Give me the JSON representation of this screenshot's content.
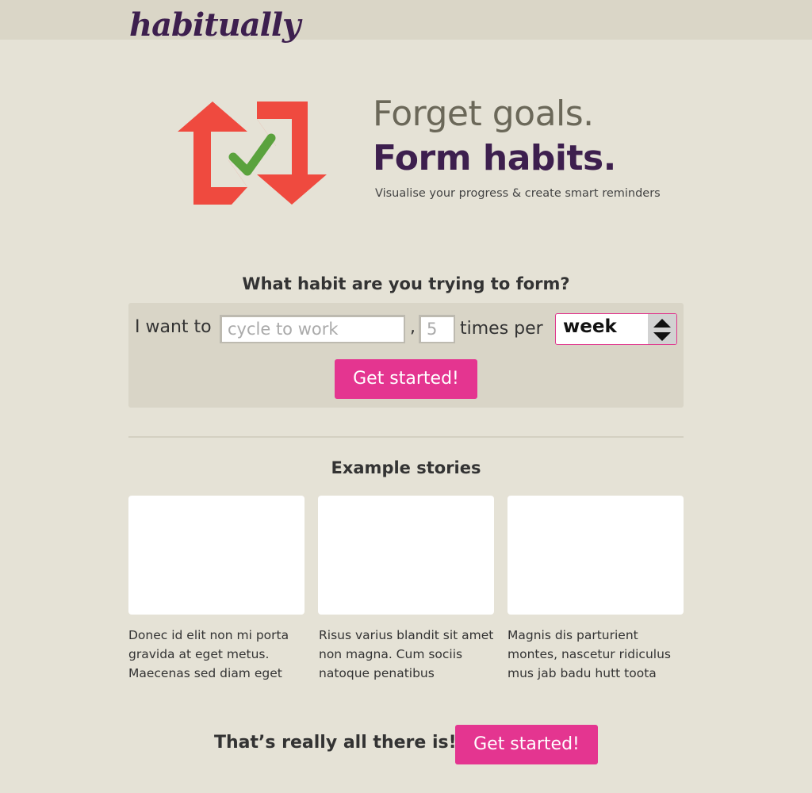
{
  "header": {
    "logo": "habitually"
  },
  "hero": {
    "icon": "refresh-check-icon",
    "headline_line1": "Forget goals.",
    "headline_line2": "Form habits.",
    "tagline": "Visualise your progress & create smart reminders"
  },
  "form": {
    "question": "What habit are you trying to form?",
    "label_want": "I want to",
    "habit_placeholder": "cycle to work",
    "comma": ",",
    "count_placeholder": "5",
    "label_times": "times per",
    "period_value": "week",
    "submit_label": "Get started!"
  },
  "stories": {
    "title": "Example stories",
    "items": [
      {
        "text": "Donec id elit non mi porta gravida at eget metus. Maecenas sed diam eget"
      },
      {
        "text": "Risus varius blandit sit amet non magna. Cum sociis natoque penatibus"
      },
      {
        "text": "Magnis dis parturient montes, nascetur ridiculus mus jab badu hutt toota"
      }
    ]
  },
  "cta": {
    "text": "That’s really all there is!",
    "button_label": "Get started!"
  },
  "colors": {
    "background": "#e5e2d6",
    "topbar": "#dad6c7",
    "brand_purple": "#3d1f4e",
    "accent_pink": "#e43590",
    "icon_red": "#ef4a3f",
    "icon_green": "#5aa23d"
  }
}
